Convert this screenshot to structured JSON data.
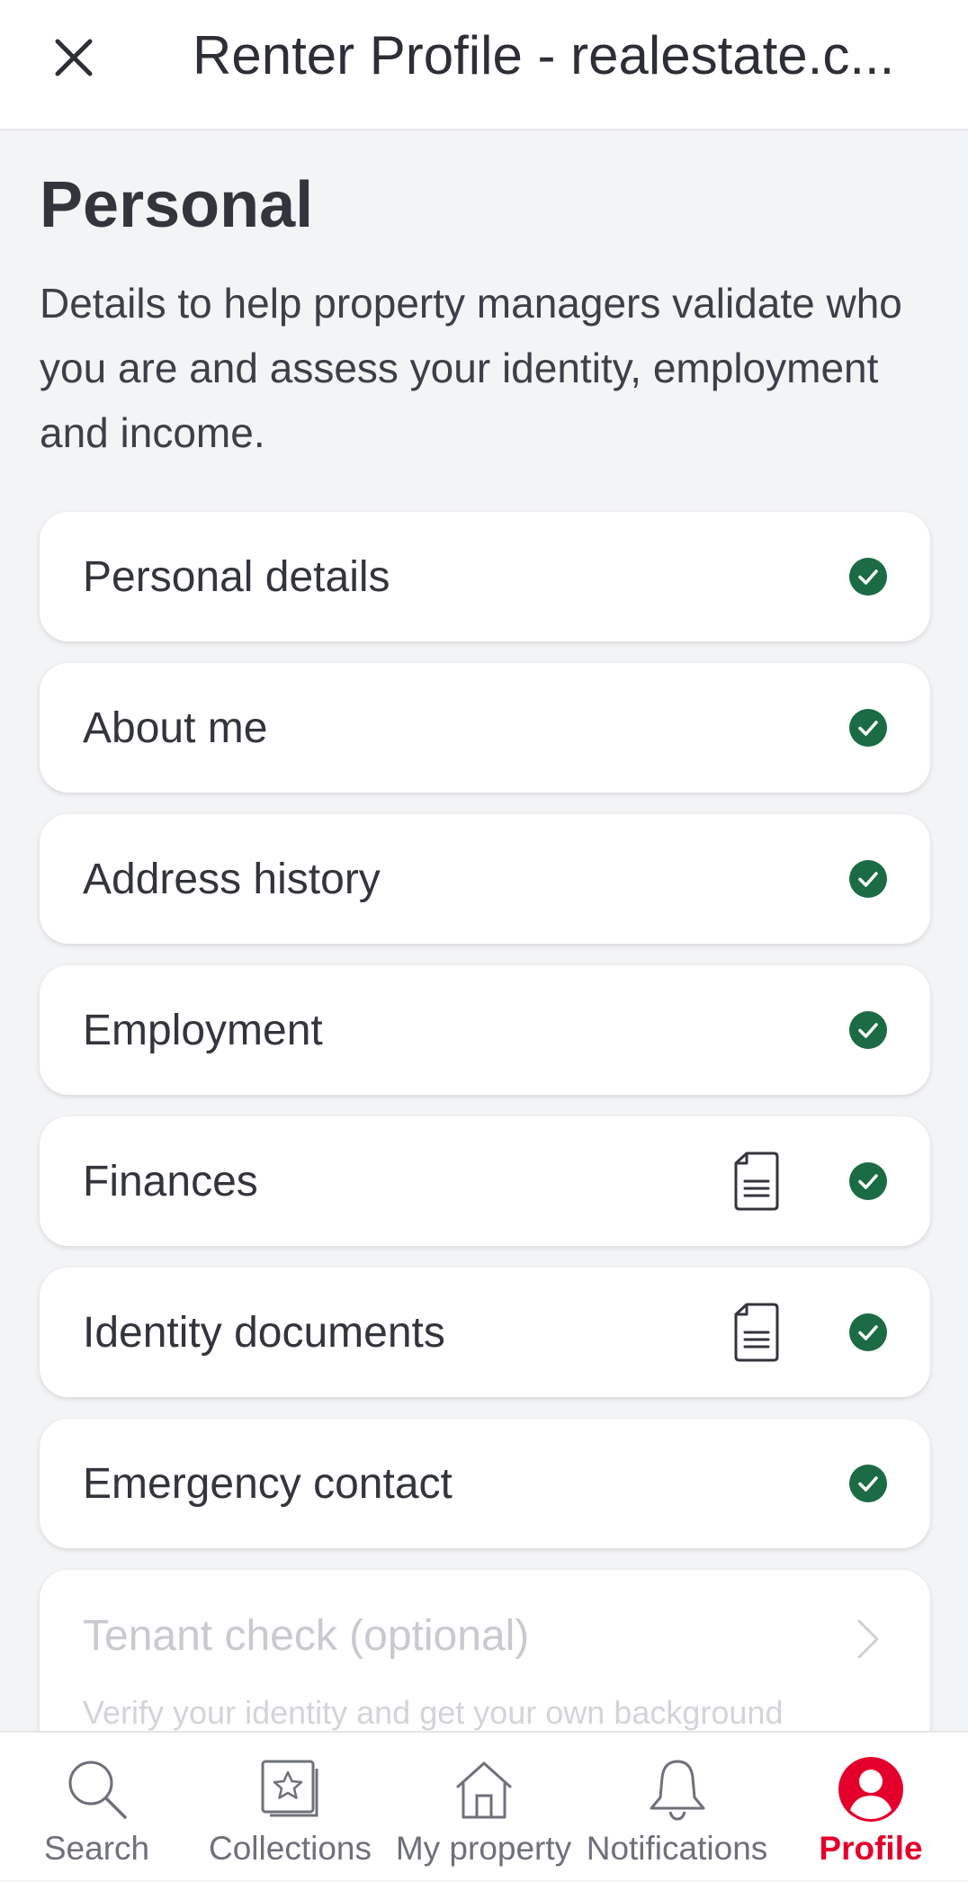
{
  "header": {
    "close_icon": "close-icon",
    "title": "Renter Profile - realestate.c..."
  },
  "section": {
    "title": "Personal",
    "description": "Details to help property managers validate who you are and assess your identity, employment and income."
  },
  "items": [
    {
      "label": "Personal details",
      "status": "complete",
      "has_document": false
    },
    {
      "label": "About me",
      "status": "complete",
      "has_document": false
    },
    {
      "label": "Address history",
      "status": "complete",
      "has_document": false
    },
    {
      "label": "Employment",
      "status": "complete",
      "has_document": false
    },
    {
      "label": "Finances",
      "status": "complete",
      "has_document": true
    },
    {
      "label": "Identity documents",
      "status": "complete",
      "has_document": true
    },
    {
      "label": "Emergency contact",
      "status": "complete",
      "has_document": false
    }
  ],
  "optional_item": {
    "label": "Tenant check (optional)",
    "subtext": "Verify your identity and get your own background"
  },
  "nav": [
    {
      "label": "Search",
      "icon": "search-icon",
      "active": false
    },
    {
      "label": "Collections",
      "icon": "collections-icon",
      "active": false
    },
    {
      "label": "My property",
      "icon": "home-icon",
      "active": false
    },
    {
      "label": "Notifications",
      "icon": "bell-icon",
      "active": false
    },
    {
      "label": "Profile",
      "icon": "profile-icon",
      "active": true
    }
  ],
  "colors": {
    "accent": "#e4002b",
    "check": "#1b6b44"
  }
}
